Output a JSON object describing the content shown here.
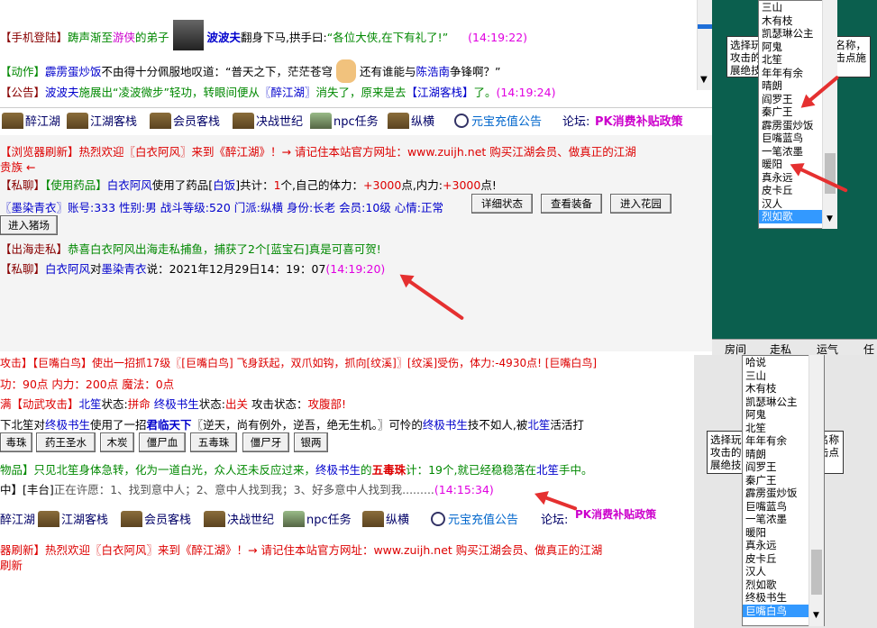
{
  "top": {
    "l1": [
      "【手机登陆】",
      "踌声渐至",
      "游侠",
      "的弟子",
      "波波夫",
      "翻身下马,拱手曰:",
      "“各位大侠,在下有礼了!”",
      "(14:19:22)"
    ],
    "l2": [
      "【动作】",
      "霹雳蛋炒饭",
      "不由得十分佩服地叹道：“普天之下，茫茫苍穹",
      "还有谁能与",
      "陈浩南",
      "争锋啊？”"
    ],
    "l3": [
      "【公告】",
      "波波夫",
      "施展出“凌波微步”轻功，转眼间便从",
      "〖醉江湖〗",
      "消失了，原来是去",
      "【江湖客栈】",
      "了。",
      "(14:19:24)"
    ],
    "nav": [
      "醉江湖",
      "江湖客栈",
      "会员客栈",
      "决战世纪",
      "npc任务",
      "纵横",
      "元宝充值公告",
      "论坛:",
      "PK消费补贴政策"
    ],
    "b1": [
      "【浏览器刷新】热烈欢迎〖白衣阿风〗来到《醉江湖》！→ 请记住本站官方网址：www.zuijh.net 购买江湖会员、做真正的江湖",
      "贵族 ←"
    ],
    "b2": [
      "【私聊】",
      "【使用药品】",
      "白衣阿风",
      "使用了药品[",
      "白饭",
      "]共计：",
      "1",
      "个,自己的体力：",
      "+3000",
      "点,内力:",
      "+3000",
      "点!"
    ],
    "b3": [
      "〖墨染青衣〗",
      "账号:333 性别:男  战斗等级:520 门派:纵横 身份:长老 会员:10级 心情:正常"
    ],
    "b3_buttons": [
      "详细状态",
      "查看装备",
      "进入花园"
    ],
    "b4_button": "进入猪场",
    "b5": [
      "【出海走私】",
      "恭喜白衣阿风出海走私捕鱼，捕获了2个[蓝宝石]真是可喜可贺!"
    ],
    "b6": [
      "【私聊】",
      "白衣阿风",
      "对",
      "墨染青衣",
      "说：2021年12月29日14：19：07",
      "(14:19:20)"
    ]
  },
  "bottom": {
    "l0": "攻击】【巨嘴白鸟】使出一招抓17级〖[巨嘴白鸟] 飞身跃起，双爪如钩，抓向[纹溪]〗[纹溪]受伤，体力:-4930点! [巨嘴白鸟]",
    "l1": "功：90点 内力：200点 魔法：0点",
    "l2": [
      "满【动武攻击】",
      "北笙",
      "状态:",
      "拼命",
      " 终极书生",
      "状态:",
      "出关",
      " 攻击状态：",
      "攻腹部!"
    ],
    "l3": [
      "下北笙对",
      "终极书生",
      "使用了一招",
      "君临天下",
      "〖逆天，尚有例外，逆吾，绝无生机。〗可怜的",
      "终极书生",
      "技不如人,被",
      "北笙",
      "活活打"
    ],
    "l3_buttons": [
      "毒珠",
      "药王圣水",
      "木炭",
      "僵尸血",
      "五毒珠",
      "僵尸牙",
      "银两"
    ],
    "l4": [
      "物品】",
      "只见北笙身体急转，化为一道白光，众人还未反应过来，",
      "终极书生",
      "的",
      "五毒珠",
      "计：19个,就已经稳稳落在",
      "北笙",
      "手中。"
    ],
    "l5": [
      "中】[丰台]",
      "正在许愿：1、找到意中人；2、意中人找到我；3、好多意中人找到我.........",
      "(14:15:34)"
    ],
    "nav": [
      "醉江湖",
      "江湖客栈",
      "会员客栈",
      "决战世纪",
      "npc任务",
      "纵横",
      "元宝充值公告",
      "论坛:",
      "PK消费补贴政策"
    ],
    "b1": [
      "器刷新】热烈欢迎〖白衣阿风〗来到《醉江湖》！→ 请记住本站官方网址：www.zuijh.net 购买江湖会员、做真正的江湖",
      "刷新"
    ]
  },
  "right_top": {
    "list": [
      "三山",
      "木有枝",
      "凯瑟琳公主",
      "阿鬼",
      "北笙",
      "年年有余",
      "晴朗",
      "阎罗王",
      "秦广王",
      "霹雳蛋炒饭",
      "巨嘴蓝鸟",
      "一笔浓墨",
      "暖阳",
      "真永远",
      "皮卡丘",
      "汉人",
      "烈如歌"
    ],
    "selected": "烈如歌",
    "side_lines": [
      "选择玩",
      "攻击的",
      "展绝技"
    ],
    "side_right": [
      "名称，",
      "击点施"
    ],
    "tabs": [
      "房间",
      "走私",
      "运气",
      "任"
    ]
  },
  "right_bottom": {
    "list": [
      "哈说",
      "三山",
      "木有枝",
      "凯瑟琳公主",
      "阿鬼",
      "北笙",
      "年年有余",
      "晴朗",
      "阎罗王",
      "秦广王",
      "霹雳蛋炒饭",
      "巨嘴蓝鸟",
      "一笔浓墨",
      "暖阳",
      "真永远",
      "皮卡丘",
      "汉人",
      "烈如歌",
      "终极书生",
      "巨嘴白鸟"
    ],
    "selected": "巨嘴白鸟",
    "side_lines": [
      "选择玩",
      "攻击的",
      "展绝技"
    ],
    "side_right": [
      "名称",
      "击点"
    ]
  },
  "colors": {
    "teal": "#0b5f4e",
    "arrow": "#e53030",
    "selection": "#3399ff"
  }
}
